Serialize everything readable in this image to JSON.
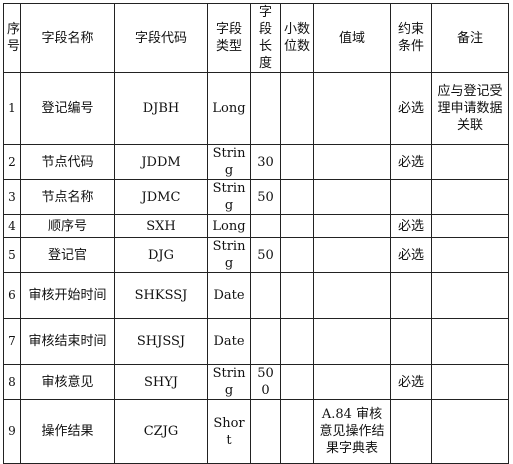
{
  "table": {
    "headers": [
      "序号",
      "字段名称",
      "字段代码",
      "字段类型",
      "字段长度",
      "小数位数",
      "值域",
      "约束条件",
      "备注"
    ],
    "rows": [
      {
        "seq": "1",
        "name": "登记编号",
        "code": "DJBH",
        "type": "Long",
        "length": "",
        "decimal": "",
        "domain": "",
        "constraint": "必选",
        "remark": "应与登记受理申请数据关联"
      },
      {
        "seq": "2",
        "name": "节点代码",
        "code": "JDDM",
        "type": "String",
        "length": "30",
        "decimal": "",
        "domain": "",
        "constraint": "必选",
        "remark": ""
      },
      {
        "seq": "3",
        "name": "节点名称",
        "code": "JDMC",
        "type": "String",
        "length": "50",
        "decimal": "",
        "domain": "",
        "constraint": "",
        "remark": ""
      },
      {
        "seq": "4",
        "name": "顺序号",
        "code": "SXH",
        "type": "Long",
        "length": "",
        "decimal": "",
        "domain": "",
        "constraint": "必选",
        "remark": ""
      },
      {
        "seq": "5",
        "name": "登记官",
        "code": "DJG",
        "type": "String",
        "length": "50",
        "decimal": "",
        "domain": "",
        "constraint": "必选",
        "remark": ""
      },
      {
        "seq": "6",
        "name": "审核开始时间",
        "code": "SHKSSJ",
        "type": "Date",
        "length": "",
        "decimal": "",
        "domain": "",
        "constraint": "",
        "remark": ""
      },
      {
        "seq": "7",
        "name": "审核结束时间",
        "code": "SHJSSJ",
        "type": "Date",
        "length": "",
        "decimal": "",
        "domain": "",
        "constraint": "",
        "remark": ""
      },
      {
        "seq": "8",
        "name": "审核意见",
        "code": "SHYJ",
        "type": "String",
        "length": "500",
        "decimal": "",
        "domain": "",
        "constraint": "必选",
        "remark": ""
      },
      {
        "seq": "9",
        "name": "操作结果",
        "code": "CZJG",
        "type": "Short",
        "length": "",
        "decimal": "",
        "domain": "A.84 审核意见操作结果字典表",
        "constraint": "",
        "remark": ""
      }
    ]
  }
}
